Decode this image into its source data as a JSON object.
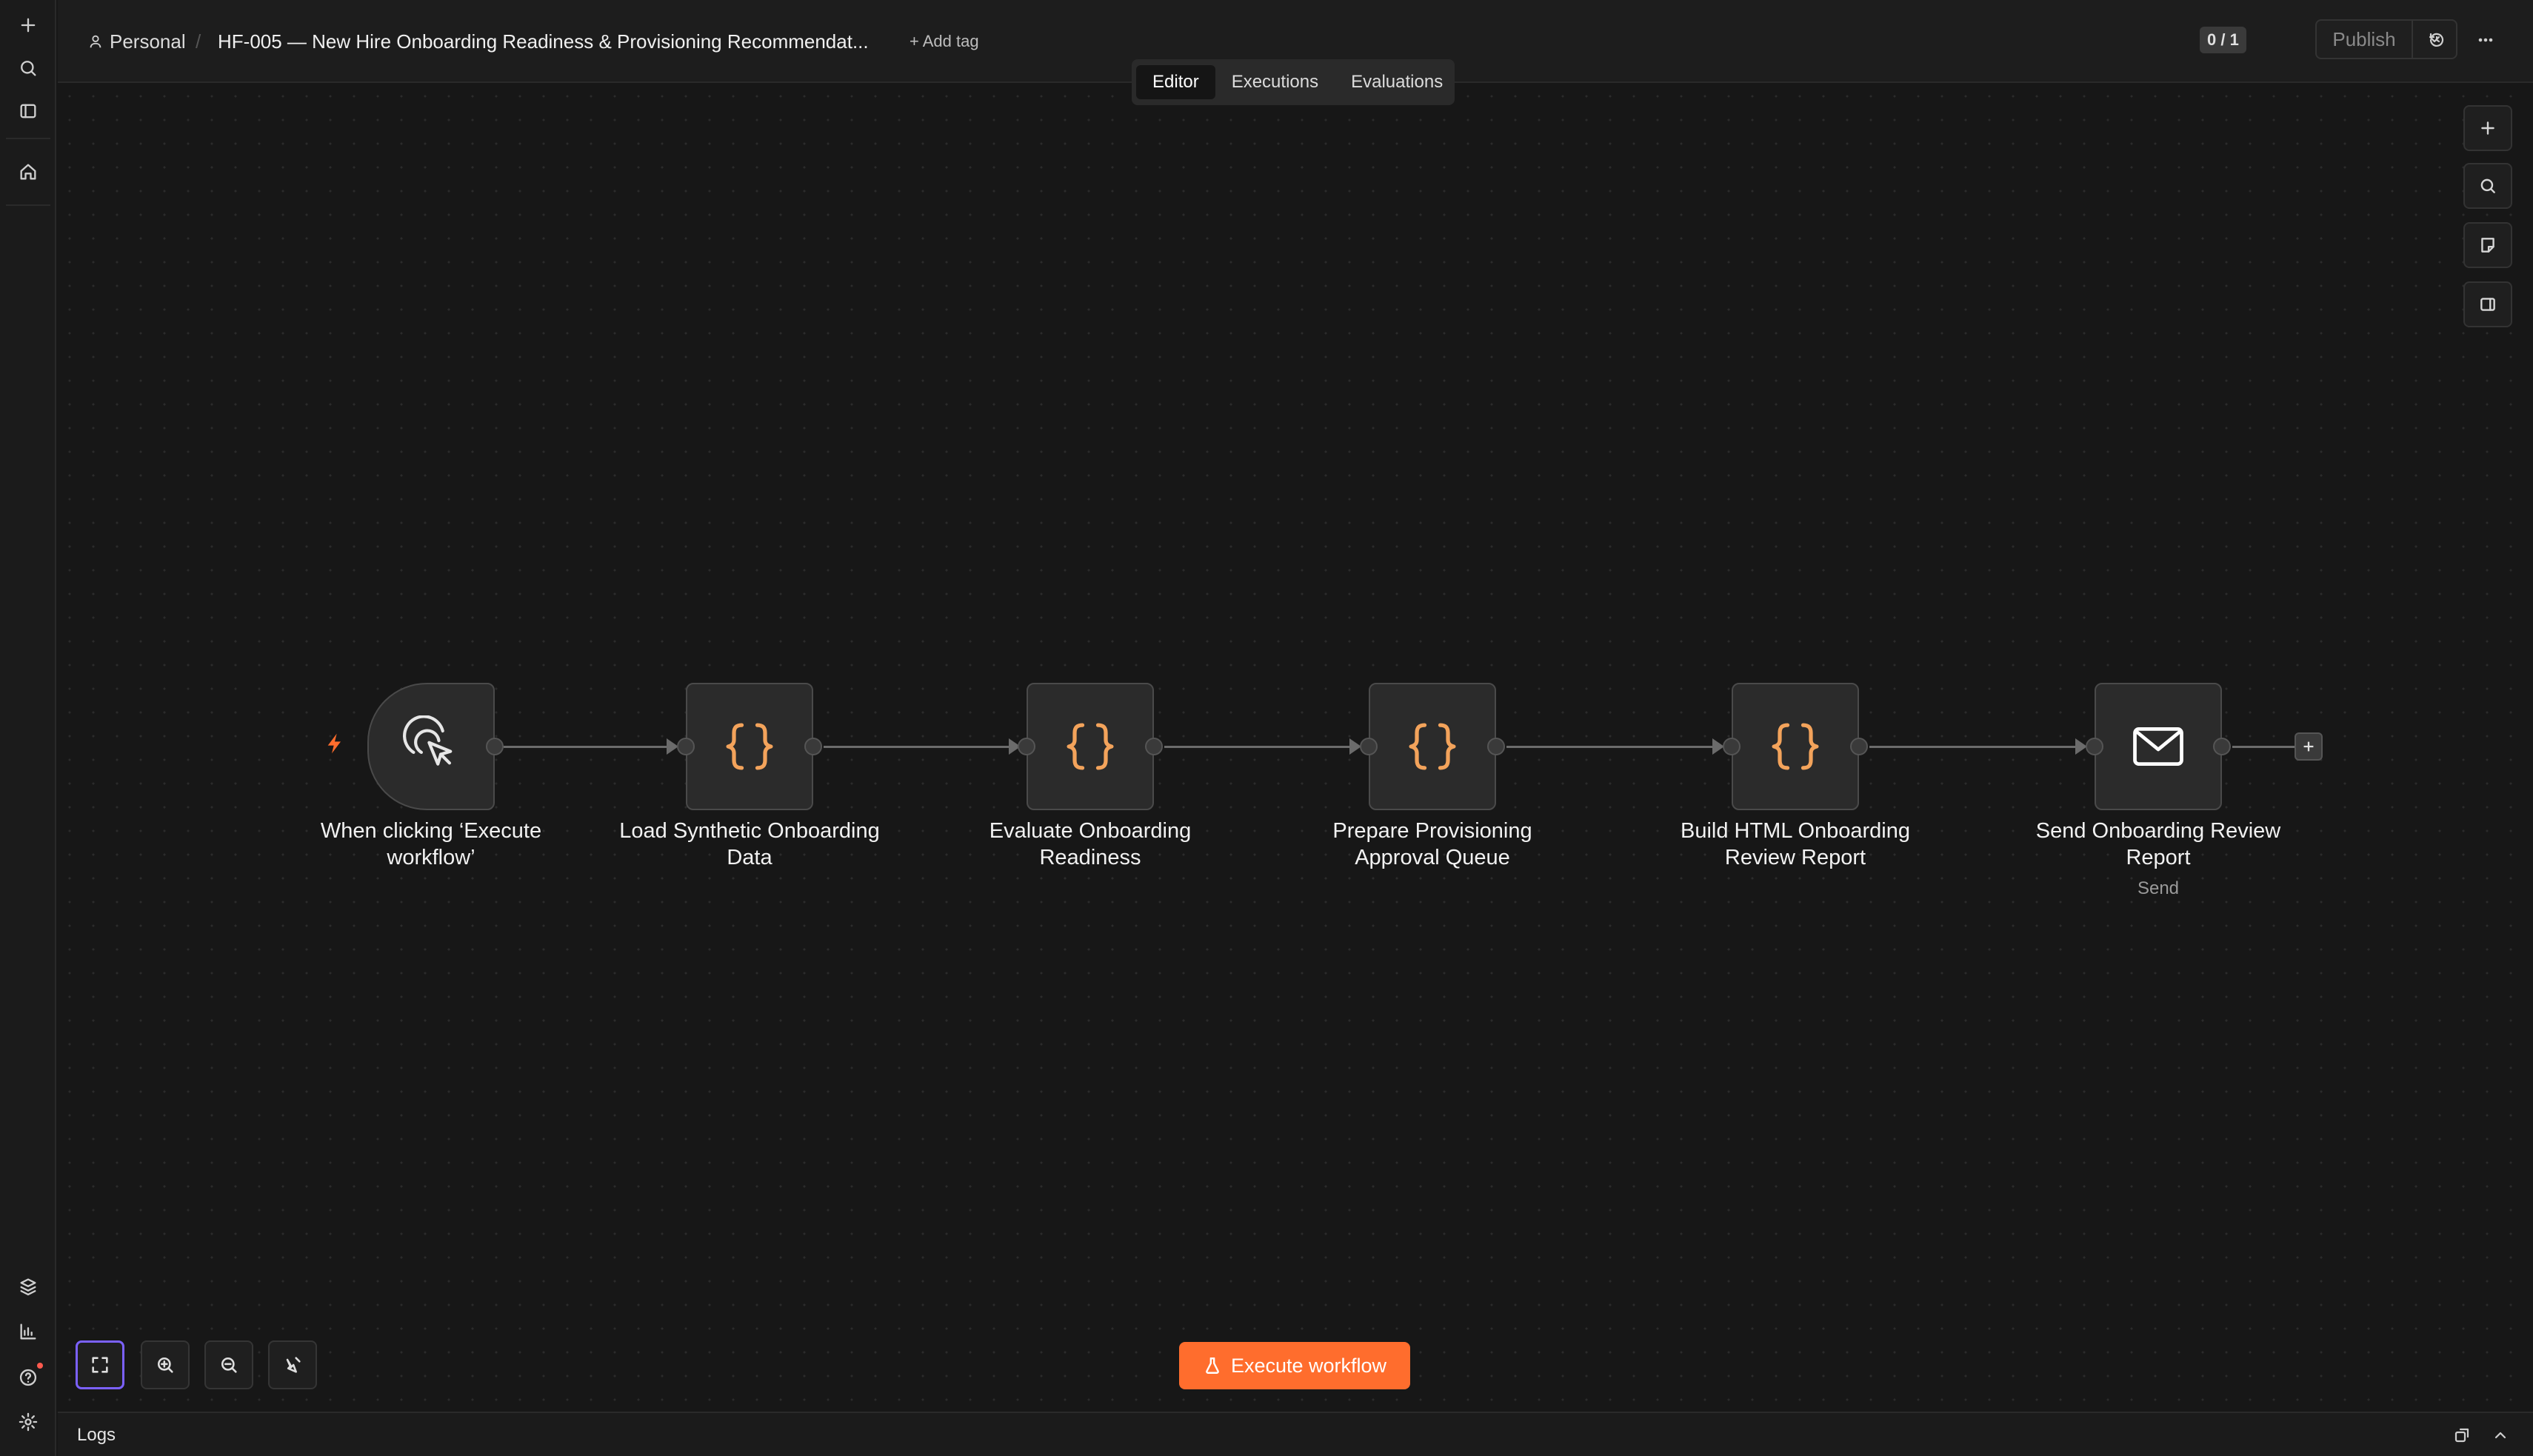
{
  "header": {
    "project": "Personal",
    "workflow_title": "HF-005 — New Hire Onboarding Readiness & Provisioning Recommendat...",
    "add_tag": "+ Add tag",
    "counter": "0 / 1",
    "publish_label": "Publish"
  },
  "tabs": [
    {
      "label": "Editor",
      "active": true
    },
    {
      "label": "Executions",
      "active": false
    },
    {
      "label": "Evaluations",
      "active": false
    }
  ],
  "nodes": [
    {
      "label": "When clicking ‘Execute workflow’",
      "icon": "cursor-click-icon"
    },
    {
      "label": "Load Synthetic Onboarding Data",
      "icon": "code-braces-icon"
    },
    {
      "label": "Evaluate Onboarding Readiness",
      "icon": "code-braces-icon"
    },
    {
      "label": "Prepare Provisioning Approval Queue",
      "icon": "code-braces-icon"
    },
    {
      "label": "Build HTML Onboarding Review Report",
      "icon": "code-braces-icon"
    },
    {
      "label": "Send Onboarding Review Report",
      "subtitle": "Send",
      "icon": "envelope-icon"
    }
  ],
  "execute_button": "Execute workflow",
  "logs_label": "Logs",
  "colors": {
    "accent": "#ff6d2d",
    "code_icon": "#f3a35b",
    "selected_outline": "#7b61ff",
    "canvas": "#171717"
  }
}
